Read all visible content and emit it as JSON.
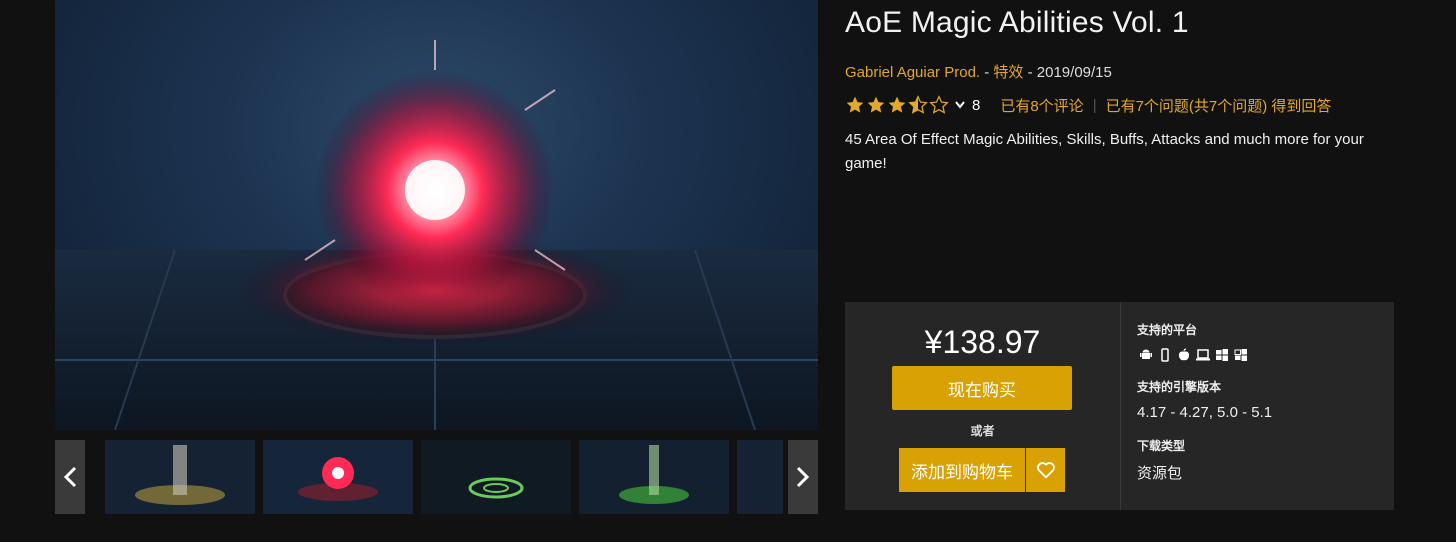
{
  "product": {
    "title": "AoE Magic Abilities Vol. 1",
    "author": "Gabriel Aguiar Prod.",
    "meta_sep1": " - ",
    "category": "特效",
    "meta_sep2": " - ",
    "date": "2019/09/15",
    "rating_stars": 3.5,
    "rating_count": "8",
    "reviews_link": "已有8个评论",
    "separator": "|",
    "qa_link": "已有7个问题(共7个问题) 得到回答",
    "description": "45 Area Of Effect Magic Abilities, Skills, Buffs, Attacks and much more for your game!"
  },
  "purchase": {
    "price": "¥138.97",
    "buy_label": "现在购买",
    "or_label": "或者",
    "cart_label": "添加到购物车",
    "wishlist_icon": "heart-icon"
  },
  "info": {
    "platforms_label": "支持的平台",
    "platform_icons": [
      "android-icon",
      "mobile-icon",
      "apple-icon",
      "laptop-icon",
      "windows-icon",
      "windows-icon"
    ],
    "engine_label": "支持的引擎版本",
    "engine_value": "4.17 - 4.27, 5.0 - 5.1",
    "download_label": "下载类型",
    "download_value": "资源包"
  },
  "gallery": {
    "prev_icon": "chevron-left-icon",
    "next_icon": "chevron-right-icon",
    "thumbnails": [
      "thumbnail-yellow-burst",
      "thumbnail-red-orb",
      "thumbnail-green-ring",
      "thumbnail-green-burst"
    ]
  },
  "colors": {
    "accent": "#d8a205",
    "link": "#e2a82a",
    "background": "#111111",
    "panel": "#262626"
  }
}
